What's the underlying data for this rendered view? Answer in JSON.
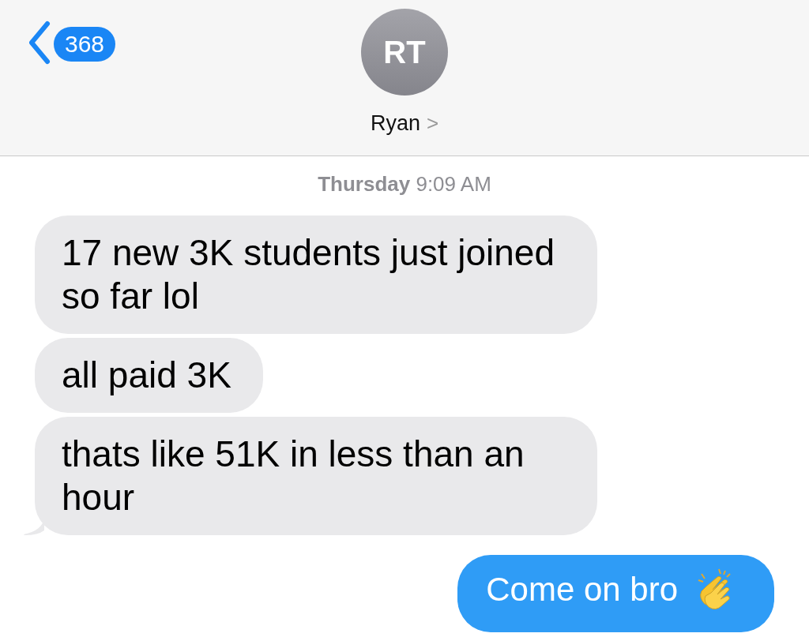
{
  "header": {
    "back_badge": "368",
    "avatar_initials": "RT",
    "contact_name": "Ryan",
    "contact_chevron": ">"
  },
  "timestamp": {
    "day": "Thursday",
    "time": "9:09 AM"
  },
  "messages": [
    {
      "kind": "received",
      "text": "17 new 3K students just joined so far lol",
      "tail": false
    },
    {
      "kind": "received",
      "text": "all paid 3K",
      "tail": false
    },
    {
      "kind": "received",
      "text": "thats like 51K in less than an hour",
      "tail": true
    },
    {
      "kind": "sent",
      "text": "Come on bro",
      "tail": false
    }
  ]
}
